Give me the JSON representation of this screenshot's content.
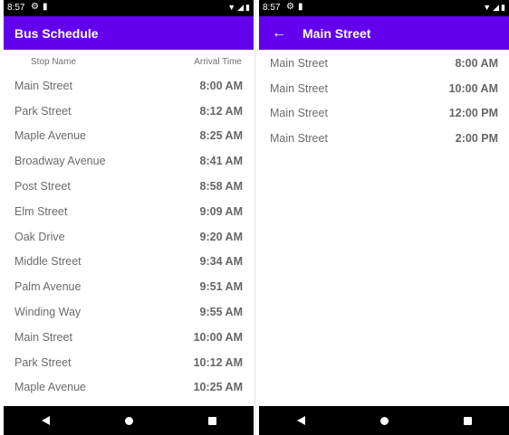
{
  "left": {
    "status": {
      "time": "8:57"
    },
    "app_title": "Bus Schedule",
    "columns": {
      "stop": "Stop Name",
      "arrival": "Arrival Time"
    },
    "rows": [
      {
        "stop": "Main Street",
        "time": "8:00 AM"
      },
      {
        "stop": "Park Street",
        "time": "8:12 AM"
      },
      {
        "stop": "Maple Avenue",
        "time": "8:25 AM"
      },
      {
        "stop": "Broadway Avenue",
        "time": "8:41 AM"
      },
      {
        "stop": "Post Street",
        "time": "8:58 AM"
      },
      {
        "stop": "Elm Street",
        "time": "9:09 AM"
      },
      {
        "stop": "Oak Drive",
        "time": "9:20 AM"
      },
      {
        "stop": "Middle Street",
        "time": "9:34 AM"
      },
      {
        "stop": "Palm Avenue",
        "time": "9:51 AM"
      },
      {
        "stop": "Winding Way",
        "time": "9:55 AM"
      },
      {
        "stop": "Main Street",
        "time": "10:00 AM"
      },
      {
        "stop": "Park Street",
        "time": "10:12 AM"
      },
      {
        "stop": "Maple Avenue",
        "time": "10:25 AM"
      }
    ]
  },
  "right": {
    "status": {
      "time": "8:57"
    },
    "app_title": "Main Street",
    "rows": [
      {
        "stop": "Main Street",
        "time": "8:00 AM"
      },
      {
        "stop": "Main Street",
        "time": "10:00 AM"
      },
      {
        "stop": "Main Street",
        "time": "12:00 PM"
      },
      {
        "stop": "Main Street",
        "time": "2:00 PM"
      }
    ]
  },
  "icons": {
    "status": [
      "gear-icon",
      "sim-icon"
    ],
    "system": [
      "wifi-icon",
      "signal-icon",
      "battery-icon"
    ],
    "app_back": "back-arrow-icon",
    "nav": [
      "nav-back-icon",
      "nav-home-icon",
      "nav-recents-icon"
    ]
  },
  "colors": {
    "app_bar": "#6200ee",
    "status_bar": "#000000",
    "nav_bar": "#000000"
  }
}
